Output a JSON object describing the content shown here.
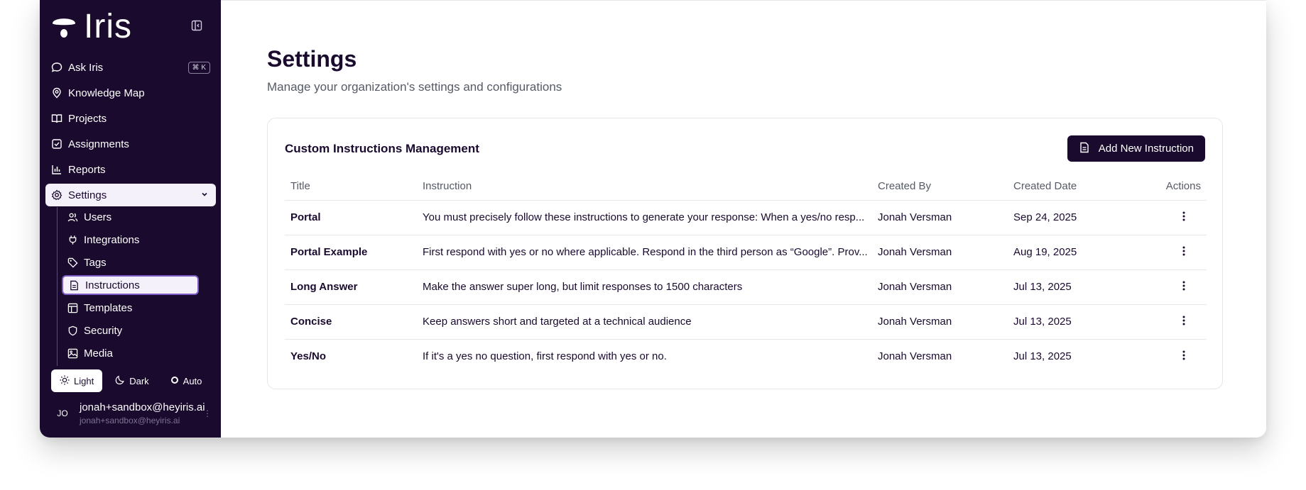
{
  "brand": {
    "name": "Iris"
  },
  "sidebar": {
    "items": [
      {
        "label": "Ask Iris",
        "icon": "chat-bubble-icon",
        "shortcut": "⌘ K"
      },
      {
        "label": "Knowledge Map",
        "icon": "map-pin-icon"
      },
      {
        "label": "Projects",
        "icon": "book-open-icon"
      },
      {
        "label": "Assignments",
        "icon": "checkbox-icon"
      },
      {
        "label": "Reports",
        "icon": "bar-chart-icon"
      },
      {
        "label": "Settings",
        "icon": "gear-icon",
        "active": true
      }
    ],
    "settings_sub": [
      {
        "label": "Users",
        "icon": "users-icon"
      },
      {
        "label": "Integrations",
        "icon": "plug-icon"
      },
      {
        "label": "Tags",
        "icon": "tag-icon"
      },
      {
        "label": "Instructions",
        "icon": "document-icon",
        "active": true
      },
      {
        "label": "Templates",
        "icon": "layout-icon"
      },
      {
        "label": "Security",
        "icon": "shield-icon"
      },
      {
        "label": "Media",
        "icon": "image-icon"
      }
    ],
    "theme": {
      "light": "Light",
      "dark": "Dark",
      "auto": "Auto",
      "selected": "Light"
    },
    "user": {
      "initials": "JO",
      "name": "jonah+sandbox@heyiris.ai",
      "email": "jonah+sandbox@heyiris.ai"
    }
  },
  "page": {
    "title": "Settings",
    "subtitle": "Manage your organization's settings and configurations"
  },
  "card": {
    "title": "Custom Instructions Management",
    "add_button": "Add New Instruction",
    "columns": [
      "Title",
      "Instruction",
      "Created By",
      "Created Date",
      "Actions"
    ],
    "rows": [
      {
        "title": "Portal",
        "instruction": "You must precisely follow these instructions to generate your response: When a yes/no resp...",
        "created_by": "Jonah Versman",
        "date": "Sep 24, 2025"
      },
      {
        "title": "Portal Example",
        "instruction": "First respond with yes or no where applicable. Respond in the third person as “Google”. Prov...",
        "created_by": "Jonah Versman",
        "date": "Aug 19, 2025"
      },
      {
        "title": "Long Answer",
        "instruction": "Make the answer super long, but limit responses to 1500 characters",
        "created_by": "Jonah Versman",
        "date": "Jul 13, 2025"
      },
      {
        "title": "Concise",
        "instruction": "Keep answers short and targeted at a technical audience",
        "created_by": "Jonah Versman",
        "date": "Jul 13, 2025"
      },
      {
        "title": "Yes/No",
        "instruction": "If it's a yes no question, first respond with yes or no.",
        "created_by": "Jonah Versman",
        "date": "Jul 13, 2025"
      }
    ]
  },
  "colors": {
    "sidebar_bg": "#1a0a2e",
    "accent": "#7c5cc4",
    "active_bg": "#f4f1fa"
  }
}
